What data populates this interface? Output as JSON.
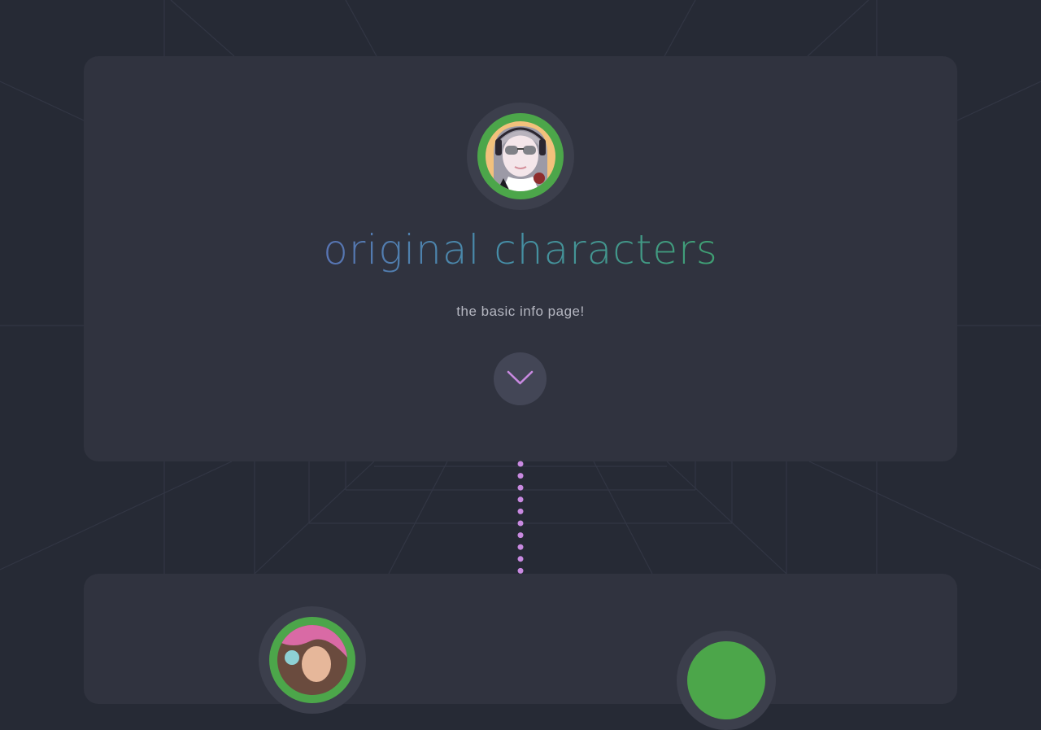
{
  "hero": {
    "title": "original characters",
    "subtitle": "the basic info page!"
  },
  "icons": {
    "scroll_down": "chevron-down-icon"
  },
  "colors": {
    "background": "#262a35",
    "card": "#30333f",
    "avatar_ring": "#4ca64a",
    "accent_purple": "#c889e0",
    "title_gradient_start": "#5874b4",
    "title_gradient_end": "#3fa072"
  }
}
